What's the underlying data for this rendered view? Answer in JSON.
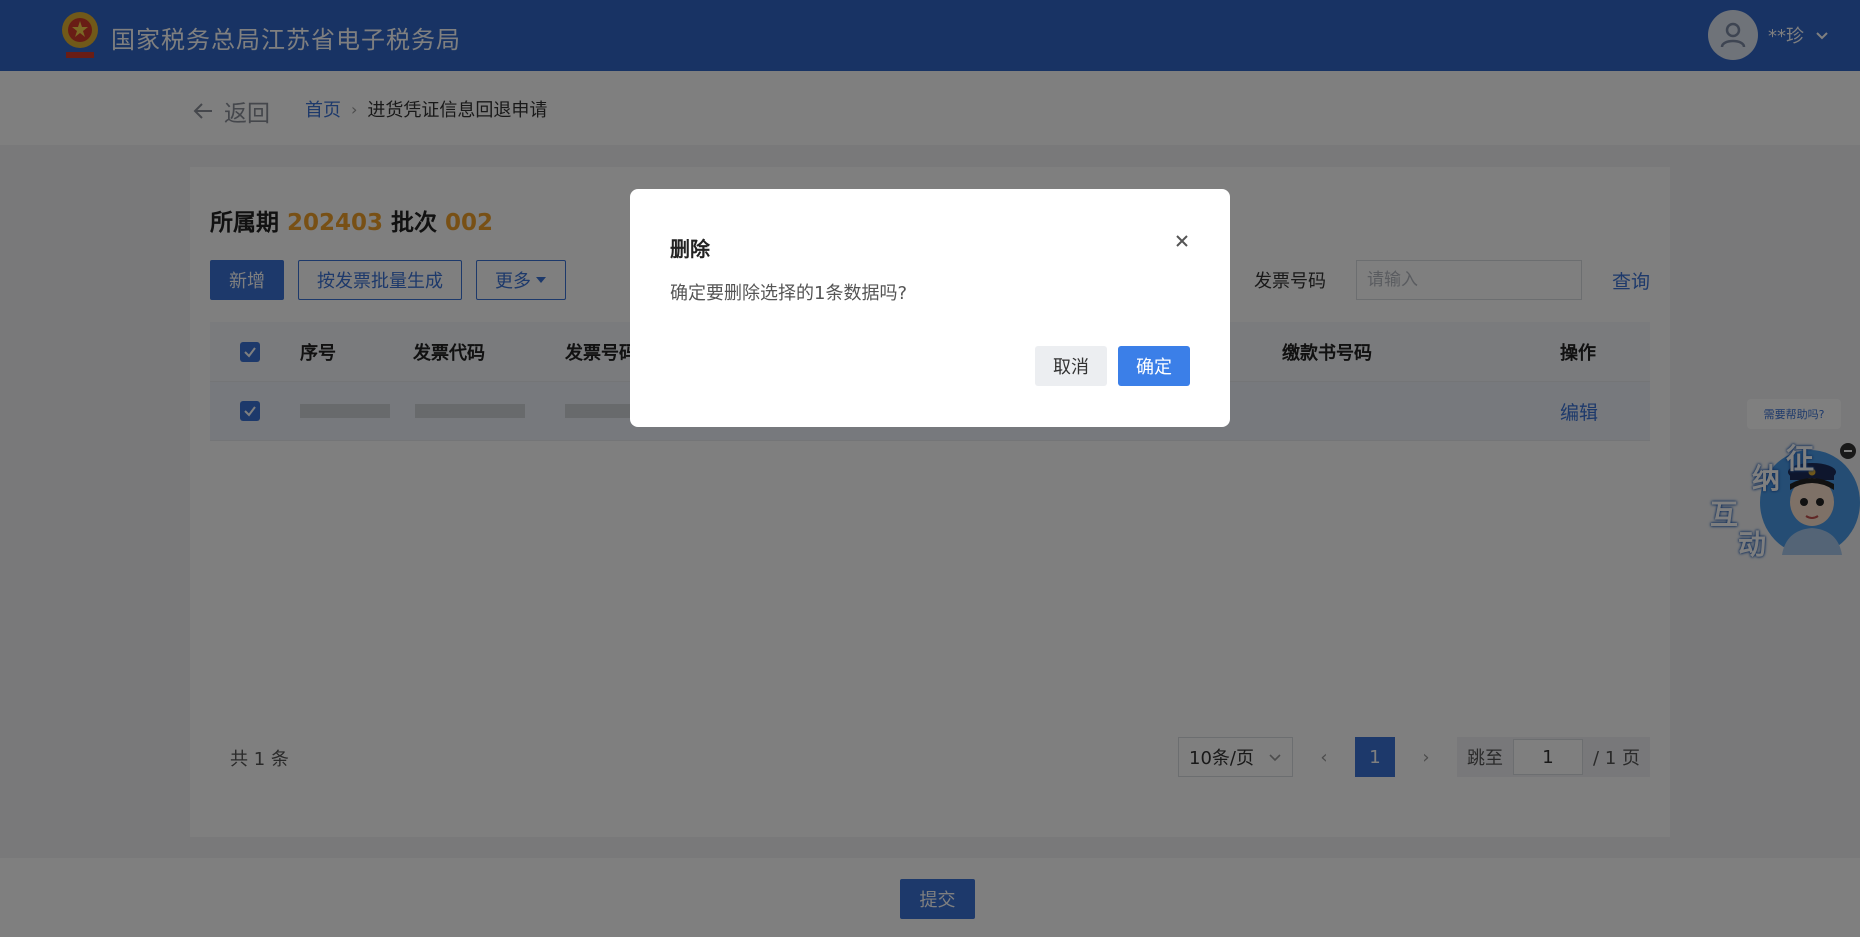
{
  "header": {
    "title": "国家税务总局江苏省电子税务局",
    "user_name": "**珍"
  },
  "subbar": {
    "back_label": "返回",
    "breadcrumb_home": "首页",
    "breadcrumb_current": "进货凭证信息回退申请"
  },
  "period": {
    "label": "所属期",
    "value": "202403",
    "batch_label": "批次",
    "batch_value": "002"
  },
  "toolbar": {
    "add_label": "新增",
    "batch_generate_label": "按发票批量生成",
    "more_label": "更多"
  },
  "filter": {
    "label": "发票号码",
    "placeholder": "请输入",
    "query_label": "查询"
  },
  "table": {
    "columns": [
      "序号",
      "发票代码",
      "发票号码",
      "缴款书号码",
      "操作"
    ],
    "rows": [
      {
        "action": "编辑"
      }
    ]
  },
  "pagination": {
    "total_label": "共 1 条",
    "page_size": "10条/页",
    "current_page": "1",
    "jump_label": "跳至",
    "jump_value": "1",
    "total_pages_label": "/ 1 页"
  },
  "footer": {
    "submit_label": "提交"
  },
  "assistant": {
    "help_label": "需要帮助吗?",
    "chars": [
      "征",
      "纳",
      "互",
      "动"
    ]
  },
  "modal": {
    "title": "删除",
    "message": "确定要删除选择的1条数据吗?",
    "cancel_label": "取消",
    "confirm_label": "确定"
  },
  "colors": {
    "brand": "#3066c9",
    "primary": "#3b73d6",
    "accent": "#f0a12b",
    "confirm": "#3b7fe8"
  }
}
